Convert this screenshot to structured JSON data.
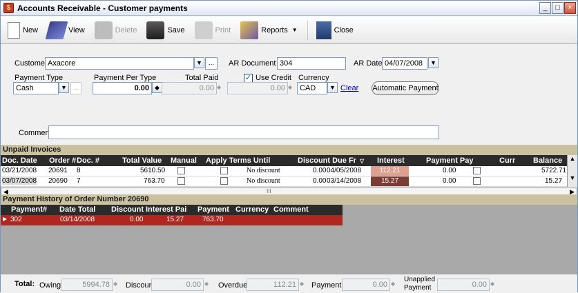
{
  "window": {
    "title": "Accounts Receivable - Customer payments"
  },
  "toolbar": {
    "new": "New",
    "view": "View",
    "delete": "Delete",
    "save": "Save",
    "print": "Print",
    "reports": "Reports",
    "close": "Close"
  },
  "form": {
    "customer_label": "Customer",
    "customer_value": "Axacore",
    "ar_doc_label": "AR Document #",
    "ar_doc_value": "304",
    "ar_date_label": "AR Date",
    "ar_date_value": "04/07/2008",
    "payment_type_label": "Payment Type",
    "payment_type_value": "Cash",
    "payment_per_type_label": "Payment Per Type",
    "payment_per_type_value": "0.00",
    "total_paid_label": "Total Paid",
    "total_paid_value": "0.00",
    "use_credit_label": "Use Credit",
    "use_credit_value": "0.00",
    "currency_label": "Currency",
    "currency_value": "CAD",
    "clear_link": "Clear",
    "auto_payment_button": "Automatic Payment",
    "comment_label": "Comment",
    "comment_value": ""
  },
  "unpaid": {
    "title": "Unpaid Invoices",
    "columns": [
      "Doc. Date",
      "Order #",
      "Doc. #",
      "Total Value",
      "Manual",
      "Apply Terms Until",
      "Discount Due Fr",
      "Interest",
      "Payment Pay",
      "Curr",
      "Balance"
    ],
    "rows": [
      {
        "doc_date": "03/21/2008",
        "order": "20691",
        "doc": "8",
        "total": "5610.50",
        "terms": "No discount",
        "discount": "0.00",
        "due": "04/05/2008",
        "interest": "112.21",
        "payment": "0.00",
        "balance": "5722.71"
      },
      {
        "doc_date": "03/07/2008",
        "order": "20690",
        "doc": "7",
        "total": "763.70",
        "terms": "No discount",
        "discount": "0.00",
        "due": "03/14/2008",
        "interest": "15.27",
        "payment": "0.00",
        "balance": "15.27"
      }
    ],
    "scroll_mark": "III"
  },
  "history": {
    "title": "Payment History of Order Number 20690",
    "columns": [
      "Payment#",
      "Date Total",
      "Discount",
      "Interest Pai",
      "Payment",
      "Currency",
      "Comment"
    ],
    "rows": [
      {
        "payment_no": "302",
        "date": "03/14/2008",
        "discount": "0.00",
        "interest": "15.27",
        "payment": "763.70",
        "currency": "",
        "comment": ""
      }
    ]
  },
  "totals": {
    "total_label": "Total:",
    "owing_label": "Owing",
    "owing_value": "5994.78",
    "discount_label": "Discount",
    "discount_value": "0.00",
    "overdue_label": "Overdue",
    "overdue_value": "112.21",
    "payment_label": "Payment",
    "payment_value": "0.00",
    "unapplied_label_1": "Unapplied",
    "unapplied_label_2": "Payment",
    "unapplied_value": "0.00"
  },
  "colors": {
    "accent_header": "#c9c1a0",
    "grid_header": "#2b2b2b",
    "selected_row": "#b0271f",
    "interest_1": "#e0a08f",
    "interest_2": "#7a3d33"
  }
}
